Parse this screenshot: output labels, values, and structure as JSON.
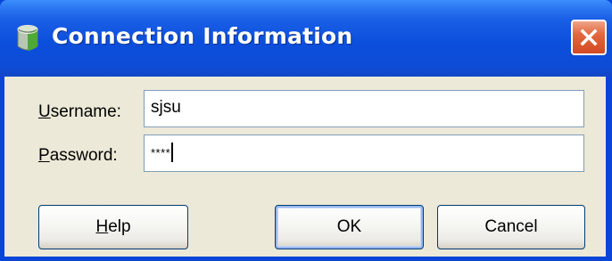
{
  "window": {
    "title": "Connection Information",
    "icon": "database-icon",
    "close_icon": "close-icon"
  },
  "form": {
    "username_label_first": "U",
    "username_label_rest": "sername:",
    "username_value": "sjsu",
    "password_label_first": "P",
    "password_label_rest": "assword:",
    "password_value": "****"
  },
  "buttons": {
    "help_first": "H",
    "help_rest": "elp",
    "ok": "OK",
    "cancel": "Cancel"
  },
  "colors": {
    "titlebar": "#0c4fdc",
    "dialog_bg": "#ece9d8",
    "close_button": "#d24a22"
  }
}
